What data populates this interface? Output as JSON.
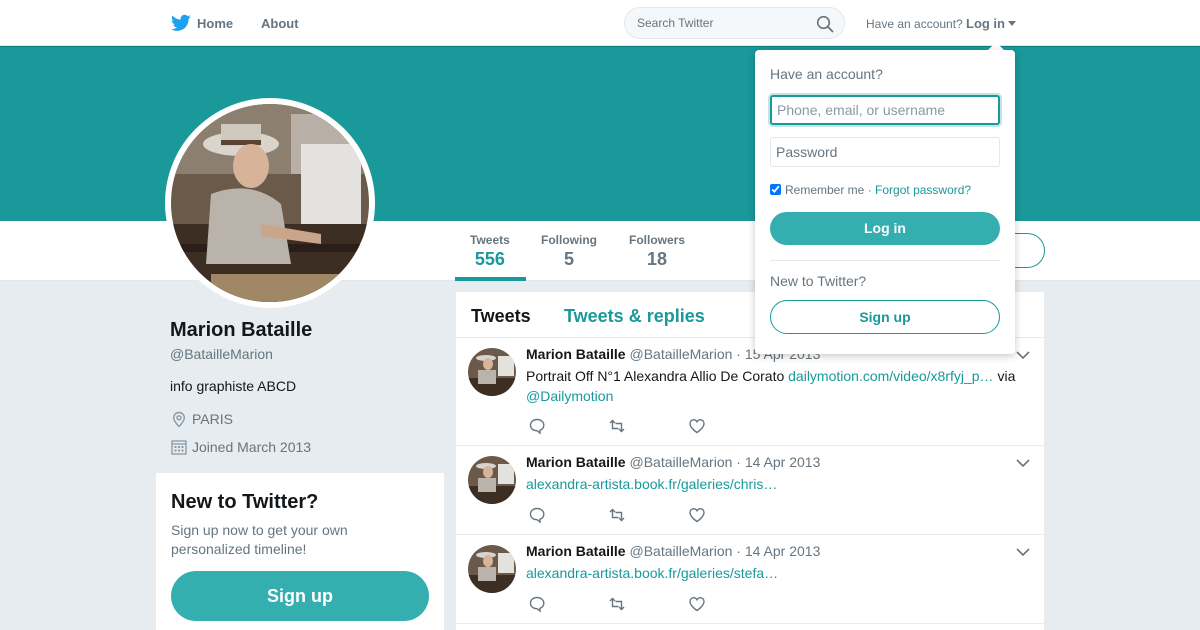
{
  "nav": {
    "home_label": "Home",
    "about_label": "About",
    "search_placeholder": "Search Twitter",
    "have_account": "Have an account?",
    "login_label": "Log in"
  },
  "profile": {
    "name": "Marion Bataille",
    "handle": "@BatailleMarion",
    "bio": "info graphiste ABCD",
    "location": "PARIS",
    "joined": "Joined March 2013",
    "stats": [
      {
        "label": "Tweets",
        "value": "556"
      },
      {
        "label": "Following",
        "value": "5"
      },
      {
        "label": "Followers",
        "value": "18"
      }
    ]
  },
  "signup_box": {
    "title": "New to Twitter?",
    "text": "Sign up now to get your own personalized timeline!",
    "button": "Sign up"
  },
  "timeline": {
    "tabs": [
      "Tweets",
      "Tweets & replies"
    ],
    "tweets": [
      {
        "name": "Marion Bataille",
        "handle": "@BatailleMarion",
        "date": "15 Apr 2013",
        "text": "Portrait Off N°1 Alexandra Allio De Corato ",
        "link": "dailymotion.com/video/x8rfyj_p…",
        "suffix": " via ",
        "mention": "@Dailymotion"
      },
      {
        "name": "Marion Bataille",
        "handle": "@BatailleMarion",
        "date": "14 Apr 2013",
        "link": "alexandra-artista.book.fr/galeries/chris…"
      },
      {
        "name": "Marion Bataille",
        "handle": "@BatailleMarion",
        "date": "14 Apr 2013",
        "link": "alexandra-artista.book.fr/galeries/stefa…"
      }
    ]
  },
  "login_dropdown": {
    "title": "Have an account?",
    "username_placeholder": "Phone, email, or username",
    "password_placeholder": "Password",
    "remember": "Remember me",
    "separator": "·",
    "forgot": "Forgot password?",
    "login_button": "Log in",
    "new_to_twitter": "New to Twitter?",
    "signup_button": "Sign up"
  },
  "colors": {
    "accent": "#19999a",
    "button": "#34aeae",
    "page_bg": "#e6ecf0"
  }
}
